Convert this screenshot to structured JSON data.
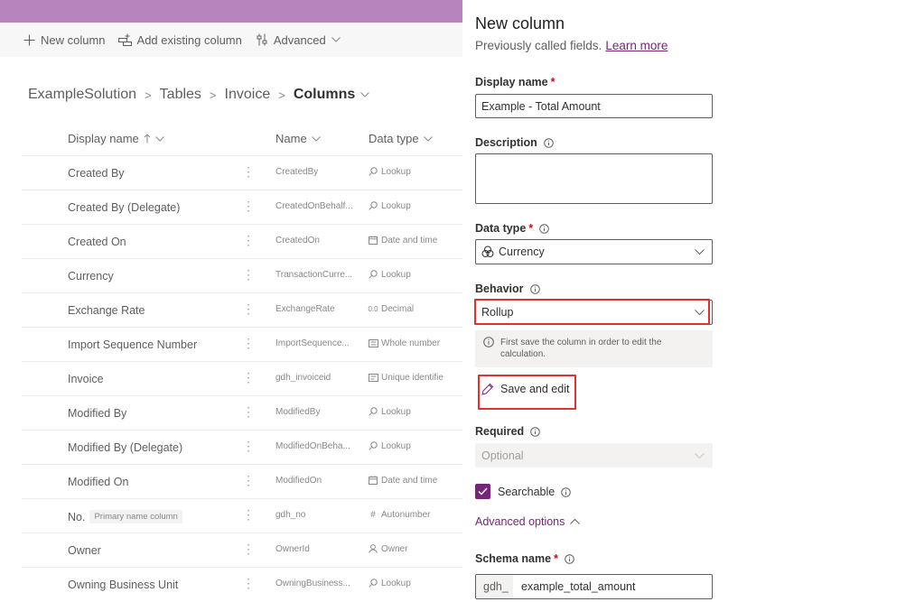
{
  "commandbar": {
    "new_column": "New column",
    "add_existing": "Add existing column",
    "advanced": "Advanced"
  },
  "breadcrumb": [
    "ExampleSolution",
    "Tables",
    "Invoice",
    "Columns"
  ],
  "table": {
    "headers": {
      "display_name": "Display name",
      "name": "Name",
      "data_type": "Data type"
    },
    "rows": [
      {
        "display": "Created By",
        "badge": "",
        "name": "CreatedBy",
        "type": "Lookup",
        "type_icon": "search-icon"
      },
      {
        "display": "Created By (Delegate)",
        "badge": "",
        "name": "CreatedOnBehalf...",
        "type": "Lookup",
        "type_icon": "search-icon"
      },
      {
        "display": "Created On",
        "badge": "",
        "name": "CreatedOn",
        "type": "Date and time",
        "type_icon": "calendar-icon"
      },
      {
        "display": "Currency",
        "badge": "",
        "name": "TransactionCurre...",
        "type": "Lookup",
        "type_icon": "search-icon"
      },
      {
        "display": "Exchange Rate",
        "badge": "",
        "name": "ExchangeRate",
        "type": "Decimal",
        "type_icon": "decimal-icon"
      },
      {
        "display": "Import Sequence Number",
        "badge": "",
        "name": "ImportSequence...",
        "type": "Whole number",
        "type_icon": "number-icon"
      },
      {
        "display": "Invoice",
        "badge": "",
        "name": "gdh_invoiceid",
        "type": "Unique identifie",
        "type_icon": "id-icon"
      },
      {
        "display": "Modified By",
        "badge": "",
        "name": "ModifiedBy",
        "type": "Lookup",
        "type_icon": "search-icon"
      },
      {
        "display": "Modified By (Delegate)",
        "badge": "",
        "name": "ModifiedOnBeha...",
        "type": "Lookup",
        "type_icon": "search-icon"
      },
      {
        "display": "Modified On",
        "badge": "",
        "name": "ModifiedOn",
        "type": "Date and time",
        "type_icon": "calendar-icon"
      },
      {
        "display": "No.",
        "badge": "Primary name column",
        "name": "gdh_no",
        "type": "Autonumber",
        "type_icon": "hash-icon"
      },
      {
        "display": "Owner",
        "badge": "",
        "name": "OwnerId",
        "type": "Owner",
        "type_icon": "person-icon"
      },
      {
        "display": "Owning Business Unit",
        "badge": "",
        "name": "OwningBusiness...",
        "type": "Lookup",
        "type_icon": "search-icon"
      }
    ]
  },
  "panel": {
    "title": "New column",
    "subtitle": "Previously called fields.",
    "learn_more": "Learn more",
    "display_name_label": "Display name",
    "display_name_value": "Example - Total Amount",
    "description_label": "Description",
    "description_value": "",
    "data_type_label": "Data type",
    "data_type_value": "Currency",
    "behavior_label": "Behavior",
    "behavior_value": "Rollup",
    "behavior_note": "First save the column in order to edit the calculation.",
    "save_and_edit": "Save and edit",
    "required_label": "Required",
    "required_value": "Optional",
    "searchable_label": "Searchable",
    "searchable_checked": true,
    "advanced_options": "Advanced options",
    "schema_name_label": "Schema name",
    "schema_prefix": "gdh_",
    "schema_value": "example_total_amount",
    "required_marker": "*"
  },
  "colors": {
    "brand": "#742774",
    "highlight": "#e03131",
    "topbar": "#b784be"
  }
}
